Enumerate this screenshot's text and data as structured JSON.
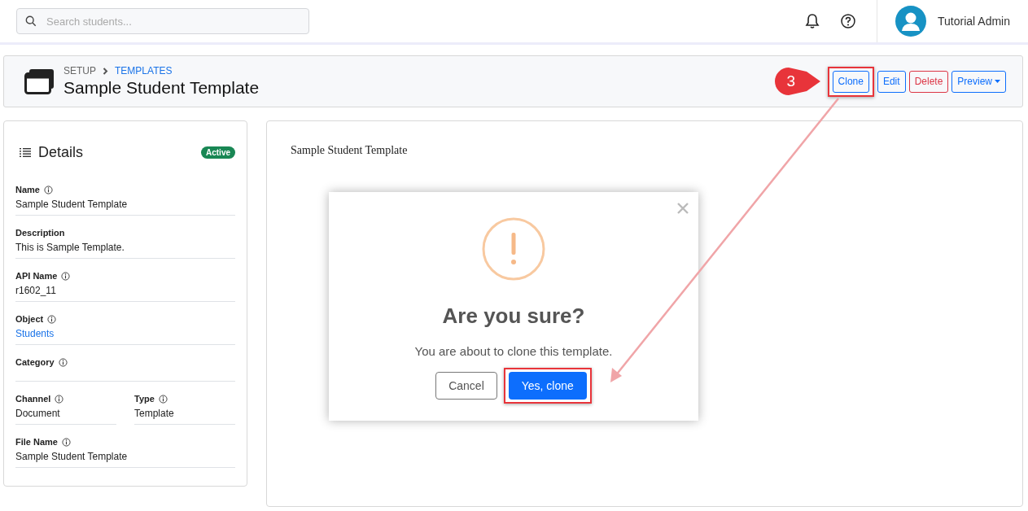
{
  "search": {
    "placeholder": "Search students..."
  },
  "user": {
    "name": "Tutorial Admin"
  },
  "page_header": {
    "breadcrumb": [
      {
        "label": "SETUP",
        "kind": "plain"
      },
      {
        "label": "TEMPLATES",
        "kind": "link"
      }
    ],
    "title": "Sample Student Template",
    "actions": [
      {
        "label": "Clone",
        "kind": "primary",
        "highlighted": true
      },
      {
        "label": "Edit",
        "kind": "primary",
        "highlighted": false
      },
      {
        "label": "Delete",
        "kind": "danger",
        "highlighted": false
      },
      {
        "label": "Preview",
        "kind": "dropdown",
        "highlighted": false
      }
    ]
  },
  "details": {
    "title": "Details",
    "status": "Active",
    "rows": [
      [
        {
          "label": "Name",
          "value": "Sample Student Template",
          "kind": "text",
          "info": true
        }
      ],
      [
        {
          "label": "Description",
          "value": "This is Sample Template.",
          "kind": "text",
          "info": false
        }
      ],
      [
        {
          "label": "API Name",
          "value": "r1602_11",
          "kind": "text",
          "info": true
        }
      ],
      [
        {
          "label": "Object",
          "value": "Students",
          "kind": "link",
          "info": true
        }
      ],
      [
        {
          "label": "Category",
          "kind": "empty",
          "info": true
        }
      ],
      [
        {
          "label": "Channel",
          "value": "Document",
          "kind": "text",
          "info": true
        },
        {
          "label": "Type",
          "value": "Template",
          "kind": "text",
          "info": true
        }
      ],
      [
        {
          "label": "File Name",
          "value": "Sample Student Template",
          "kind": "text",
          "info": true
        }
      ]
    ]
  },
  "document": {
    "text": "Sample Student Template"
  },
  "dialog": {
    "title": "Are you sure?",
    "message": "You are about to clone this template.",
    "buttons": [
      {
        "label": "Cancel",
        "kind": "secondary",
        "highlighted": false
      },
      {
        "label": "Yes, clone",
        "kind": "confirm",
        "highlighted": true
      }
    ]
  },
  "annotation": {
    "step": "3"
  }
}
